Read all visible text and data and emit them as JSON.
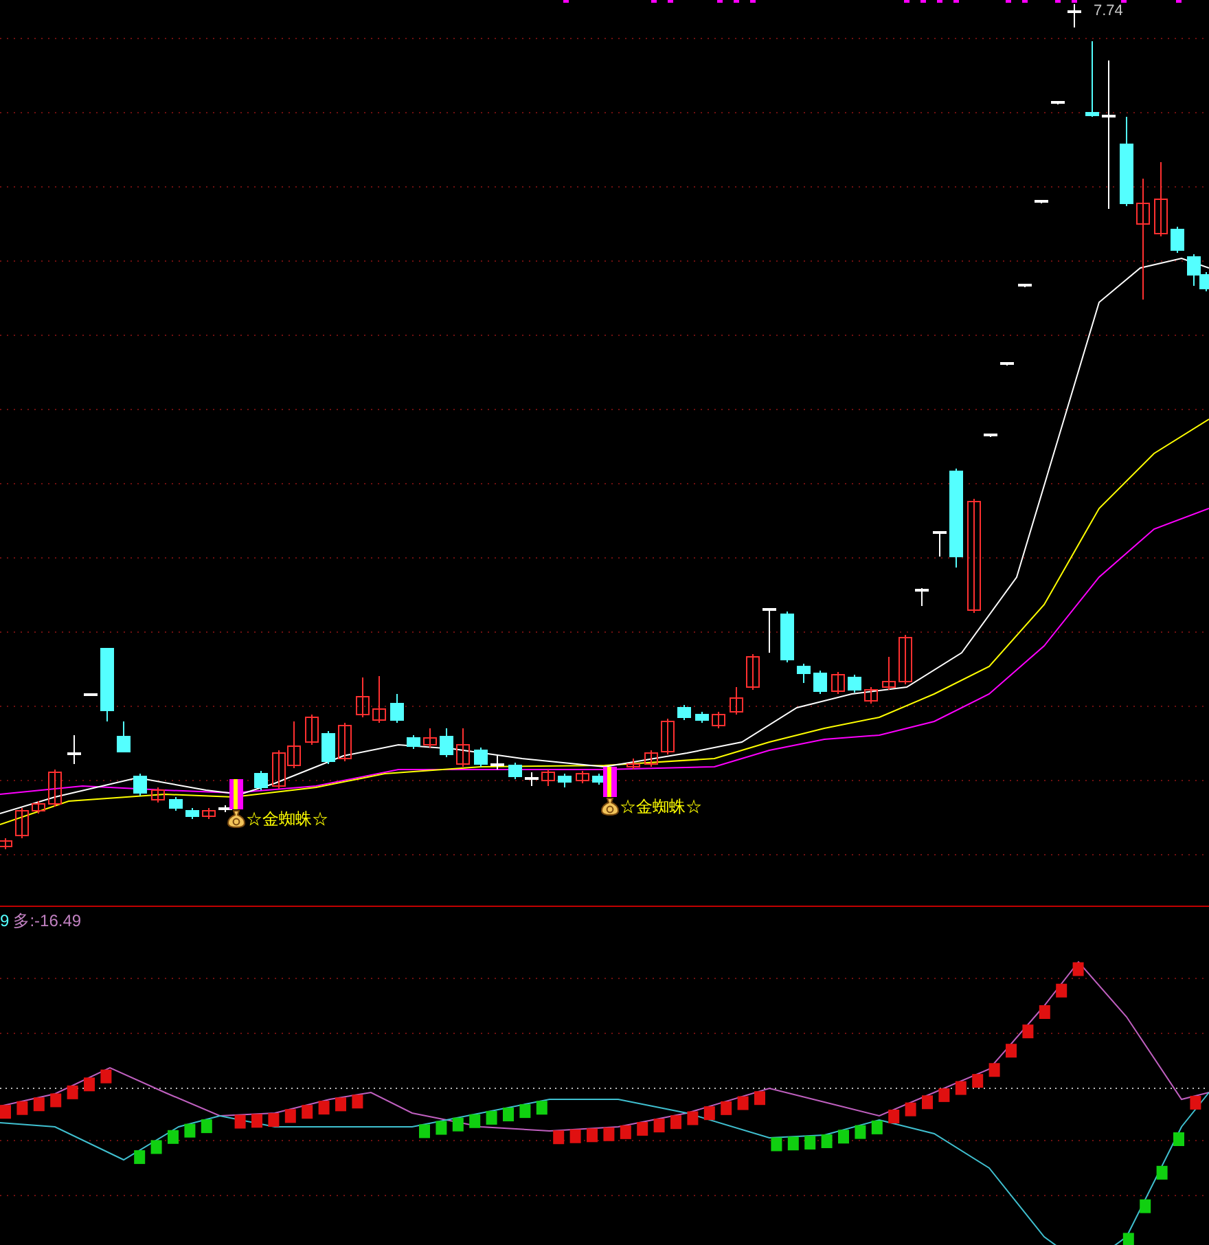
{
  "price_chart": {
    "high_label": "7.74",
    "signals": [
      {
        "label": "☆金蜘蛛☆"
      },
      {
        "label": "☆金蜘蛛☆"
      }
    ]
  },
  "indicator": {
    "label_prefix": "9",
    "label": "多:-16.49"
  }
}
